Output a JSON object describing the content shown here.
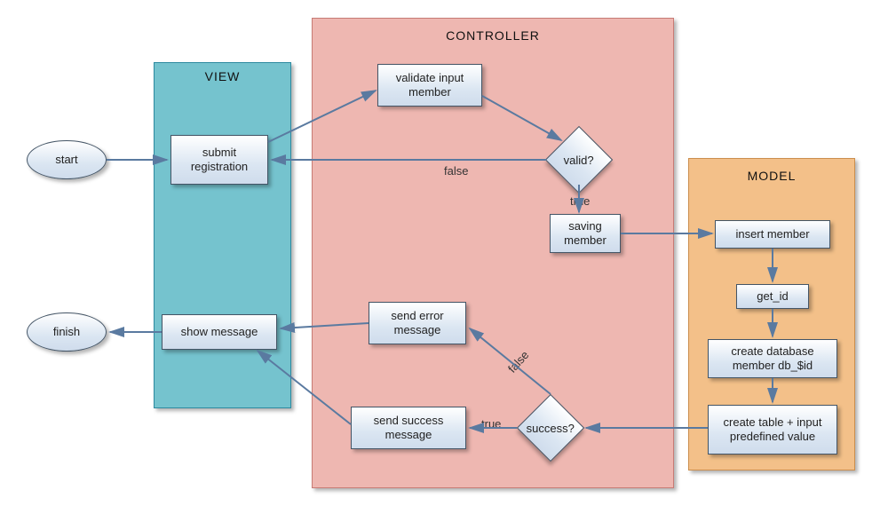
{
  "containers": {
    "view": {
      "title": "VIEW"
    },
    "controller": {
      "title": "CONTROLLER"
    },
    "model": {
      "title": "MODEL"
    }
  },
  "nodes": {
    "start": "start",
    "finish": "finish",
    "submit": "submit registration",
    "show_message": "show message",
    "validate": "validate input member",
    "valid": "valid?",
    "saving": "saving member",
    "send_err": "send error message",
    "send_ok": "send success message",
    "success": "success?",
    "insert": "insert member",
    "get_id": "get_id",
    "create_db": "create database member db_$id",
    "create_table": "create table + input predefined value"
  },
  "labels": {
    "false1": "false",
    "true1": "true",
    "false2": "false",
    "true2": "true"
  }
}
